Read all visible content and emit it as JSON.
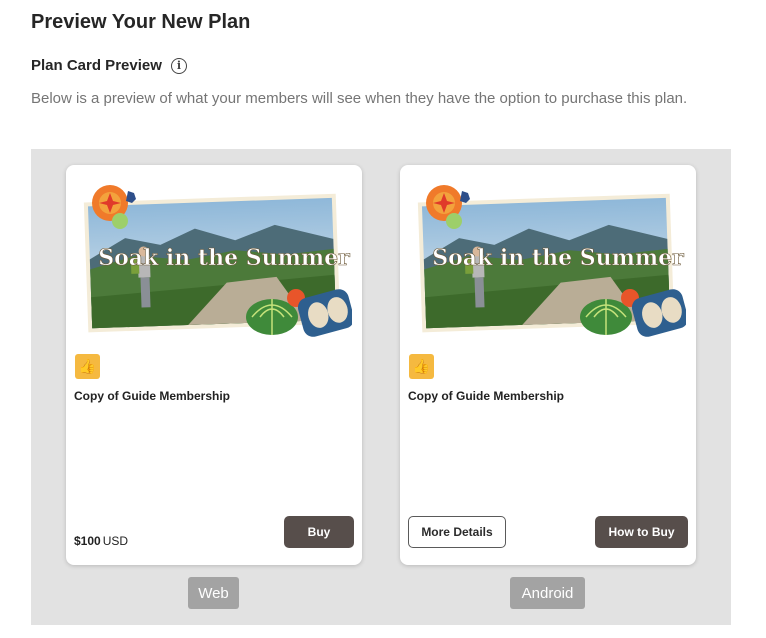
{
  "header": {
    "title": "Preview Your New Plan"
  },
  "section": {
    "title": "Plan Card Preview",
    "info_icon": "info-icon",
    "description": "Below is a preview of what your members will see when they have the option to purchase this plan."
  },
  "image": {
    "caption": "Soak in the Summer"
  },
  "web_card": {
    "emoji": "👍",
    "name": "Copy of Guide Membership",
    "price_amount": "$100",
    "price_currency": "USD",
    "buy_label": "Buy"
  },
  "android_card": {
    "emoji": "👍",
    "name": "Copy of Guide Membership",
    "more_details_label": "More Details",
    "how_to_buy_label": "How to Buy"
  },
  "platforms": {
    "web": "Web",
    "android": "Android"
  },
  "colors": {
    "preview_bg": "#e2e2e2",
    "button_dark": "#574e4b",
    "label_bg": "#a3a3a3",
    "emoji_bg": "#f5b940"
  }
}
